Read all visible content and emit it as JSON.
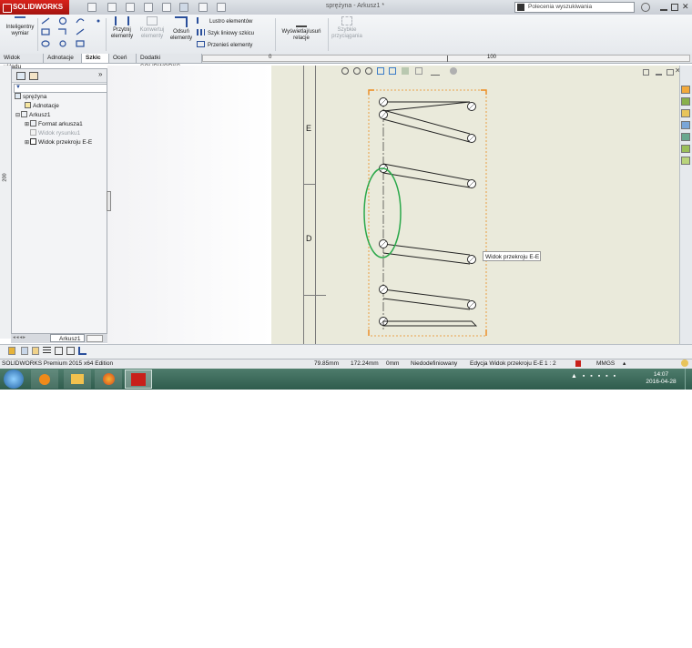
{
  "app": {
    "brand": "SOLIDWORKS",
    "doc_title": "sprężyna - Arkusz1 *"
  },
  "search": {
    "placeholder": "Polecenia wyszukiwania"
  },
  "ribbon": {
    "smart_dim": "Inteligentny",
    "smart_dim2": "wymiar",
    "trim1": "Przytnij",
    "trim2": "elementy",
    "convert1": "Konwertuj",
    "convert2": "elementy",
    "offset1": "Odsuń",
    "offset2": "elementy",
    "mirror": "Lustro elementów",
    "pattern": "Szyk liniowy szkicu",
    "move": "Przenieś elementy",
    "relations1": "Wyświetlaj/usuń",
    "relations2": "relacje",
    "snap1": "Szybkie",
    "snap2": "przyciągania"
  },
  "tabs": [
    "Widok układu",
    "Adnotacje",
    "Szkic",
    "Oceń",
    "Dodatki SOLIDWORKS"
  ],
  "ruler_top": {
    "zero": "0",
    "hundred": "100"
  },
  "left_ruler": {
    "label": "200"
  },
  "tree": {
    "root": "sprężyna",
    "annotations": "Adnotacje",
    "sheet": "Arkusz1",
    "format": "Format arkusza1",
    "view": "Widok rysunku1",
    "section": "Widok przekroju E-E"
  },
  "sheet_tab": "Arkusz1",
  "zones": {
    "e": "E",
    "d": "D"
  },
  "tooltip": "Widok przekroju E-E",
  "status": {
    "edition": "SOLIDWORKS Premium 2015 x64 Edition",
    "x": "79.85mm",
    "y": "172.24mm",
    "z": "0mm",
    "state": "Niedodefiniowany",
    "editing": "Edycja Widok przekroju E-E",
    "scale": "1 : 2",
    "units": "MMGS"
  },
  "clock": {
    "time": "14:07",
    "date": "2016-04-28"
  },
  "colors": {
    "brand_red": "#c8201a",
    "accent_orange": "#ec8a1c",
    "green_circle": "#2aa84a"
  }
}
